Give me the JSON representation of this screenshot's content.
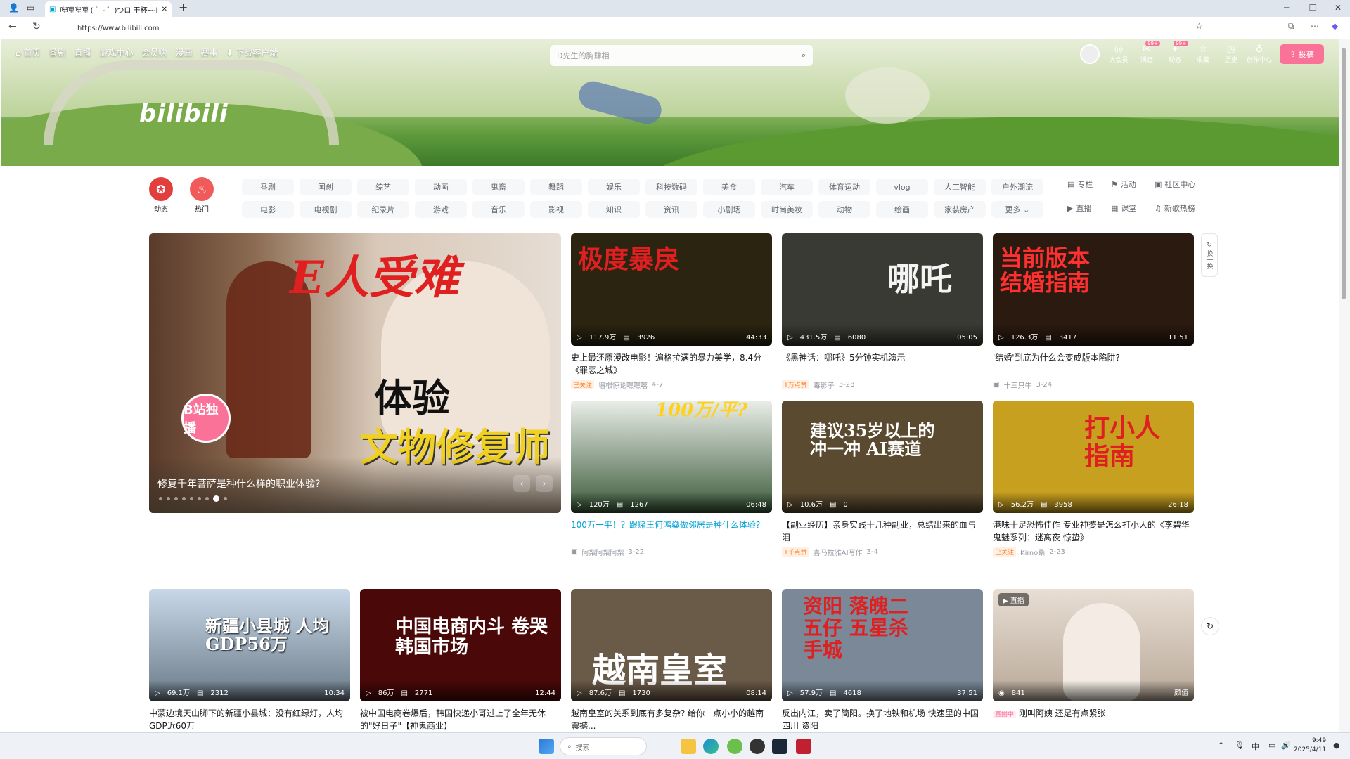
{
  "browser": {
    "tab_title": "哔哩哔哩 ( ゜- ゜)つロ 干杯~-bilibili",
    "url": "https://www.bilibili.com"
  },
  "header": {
    "nav": [
      "首页",
      "番剧",
      "直播",
      "游戏中心",
      "会员购",
      "漫画",
      "赛事",
      "下载客户端"
    ],
    "search_placeholder": "D先生的胸肆相",
    "logo_text": "bilibili",
    "right_items": [
      {
        "icon": "vip-icon",
        "label": "大会员",
        "badge": ""
      },
      {
        "icon": "message-icon",
        "label": "消息",
        "badge": "99+"
      },
      {
        "icon": "dynamic-icon",
        "label": "动态",
        "badge": "99+"
      },
      {
        "icon": "star-icon",
        "label": "收藏",
        "badge": ""
      },
      {
        "icon": "clock-icon",
        "label": "历史",
        "badge": ""
      },
      {
        "icon": "bulb-icon",
        "label": "创作中心",
        "badge": ""
      }
    ],
    "upload_label": "投稿"
  },
  "channels": {
    "dynamic_label": "动态",
    "hot_label": "热门",
    "items": [
      "番剧",
      "国创",
      "综艺",
      "动画",
      "鬼畜",
      "舞蹈",
      "娱乐",
      "科技数码",
      "美食",
      "汽车",
      "体育运动",
      "vlog",
      "电影",
      "电视剧",
      "纪录片",
      "游戏",
      "音乐",
      "影视",
      "知识",
      "资讯",
      "小剧场",
      "时尚美妆",
      "动物",
      "绘画"
    ],
    "row1_extra": [
      "人工智能",
      "户外潮流"
    ],
    "row2_extra": [
      "家装房产",
      "更多"
    ],
    "side": [
      "专栏",
      "活动",
      "社区中心",
      "直播",
      "课堂",
      "新歌热榜"
    ]
  },
  "carousel": {
    "caption": "修复千年菩萨是种什么样的职业体验?",
    "text1": "E人受难",
    "text2": "体验",
    "text3": "文物修复师",
    "badge": "B站独播"
  },
  "refresh_label": "换一换",
  "cards": [
    {
      "thumb_text": "极度暴戾",
      "views": "117.9万",
      "danmaku": "3926",
      "duration": "44:33",
      "title": "史上最还原漫改电影！遍格拉满的暴力美学，8.4分《罪恶之城》",
      "tag": "已关注",
      "author": "墙根惊论嘿嘿嘻",
      "date": "4-7",
      "bg": "#2a2410",
      "fg": "#e02020"
    },
    {
      "thumb_text": "哪吒",
      "views": "431.5万",
      "danmaku": "6080",
      "duration": "05:05",
      "title": "《黑神话：哪吒》5分钟实机演示",
      "tag": "1万点赞",
      "author": "毒影子",
      "date": "3-28",
      "bg": "#3a3a34",
      "fg": "#f4f4f4"
    },
    {
      "thumb_text": "当前版本结婚指南",
      "views": "126.3万",
      "danmaku": "3417",
      "duration": "11:51",
      "title": "'结婚'到底为什么会变成版本陷阱?",
      "tag": "",
      "author": "十三只牛",
      "date": "3-24",
      "bg": "#2a1a10",
      "fg": "#ff3030"
    },
    {
      "thumb_text": "100万/平?",
      "views": "120万",
      "danmaku": "1267",
      "duration": "06:48",
      "title": "100万一平！？跟赌王何鸿燊做邻居是种什么体验?",
      "tag": "",
      "author": "阿梨阿梨阿梨",
      "date": "3-22",
      "bg": "#3a5a3a",
      "fg": "#ffd020"
    },
    {
      "thumb_text": "建议35岁以上的冲一冲 AI赛道",
      "views": "10.6万",
      "danmaku": "0",
      "duration": "",
      "title": "【副业经历】亲身实践十几种副业，总结出来的血与泪",
      "tag": "1千点赞",
      "author": "喜马拉雅AI写作",
      "date": "3-4",
      "bg": "#5a4a30",
      "fg": "#ffffff"
    },
    {
      "thumb_text": "打小人指南",
      "views": "56.2万",
      "danmaku": "3958",
      "duration": "26:18",
      "title": "港味十足恐怖佳作 专业神婆是怎么打小人的《李碧华鬼魅系列：迷离夜 惊蛰》",
      "tag": "已关注",
      "author": "Kimo桑",
      "date": "2-23",
      "bg": "#c8a020",
      "fg": "#e02020"
    },
    {
      "thumb_text": "新疆小县城 人均GDP56万",
      "views": "69.1万",
      "danmaku": "2312",
      "duration": "10:34",
      "title": "中蒙边境天山脚下的新疆小县城：没有红绿灯，人均GDP近60万",
      "tag": "",
      "author": "",
      "date": "",
      "bg": "#8aa0b8",
      "fg": "#ffffff"
    },
    {
      "thumb_text": "中国电商内斗 卷哭韩国市场",
      "views": "86万",
      "danmaku": "2771",
      "duration": "12:44",
      "title": "被中国电商卷爆后，韩国快递小哥过上了全年无休的\"好日子\"【神鬼商业】",
      "tag": "",
      "author": "",
      "date": "",
      "bg": "#4a0808",
      "fg": "#ffffff"
    },
    {
      "thumb_text": "越南皇室",
      "views": "87.6万",
      "danmaku": "1730",
      "duration": "08:14",
      "title": "越南皇室的关系到底有多复杂? 给你一点小小的越南震撼...",
      "tag": "",
      "author": "",
      "date": "",
      "bg": "#6a5a48",
      "fg": "#ffffff"
    },
    {
      "thumb_text": "资阳 落魄二五仔 五星杀手城",
      "views": "57.9万",
      "danmaku": "4618",
      "duration": "37:51",
      "title": "反出内江，卖了简阳。换了地铁和机场 快速里的中国 四川 资阳",
      "tag": "",
      "author": "",
      "date": "",
      "bg": "#7a8898",
      "fg": "#e02020"
    },
    {
      "thumb_text": "",
      "views": "841",
      "danmaku": "",
      "duration": "颜值",
      "title": "刚叫阿姨 还是有点紧张",
      "tag": "直播中",
      "author": "",
      "date": "",
      "bg": "#d8c8b8",
      "fg": "#ffffff",
      "live_label": "直播"
    }
  ],
  "taskbar": {
    "search_placeholder": "搜索",
    "time": "9:49",
    "date": "2025/4/11",
    "ime": "中"
  }
}
